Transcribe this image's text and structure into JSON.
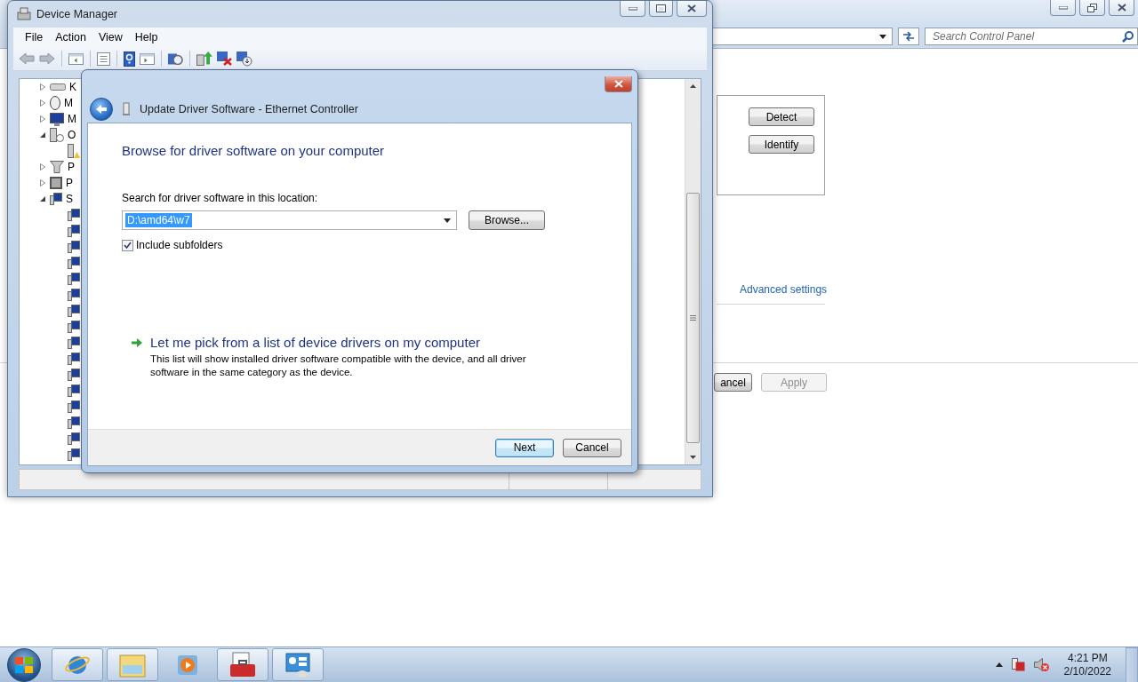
{
  "control_panel": {
    "search": {
      "placeholder": "Search Control Panel"
    },
    "buttons": [
      {
        "label": "Detect"
      },
      {
        "label": "Identify"
      }
    ],
    "link": "Advanced settings",
    "footer_buttons": [
      {
        "label": "ancel",
        "disabled": false
      },
      {
        "label": "Apply",
        "disabled": true
      }
    ]
  },
  "device_manager": {
    "title": "Device Manager",
    "menu": [
      "File",
      "Action",
      "View",
      "Help"
    ],
    "tree": [
      {
        "label": "K",
        "kind": "keyboard",
        "expanded": false
      },
      {
        "label": "M",
        "kind": "mouse",
        "expanded": false
      },
      {
        "label": "M",
        "kind": "monitor",
        "expanded": false
      },
      {
        "label": "O",
        "kind": "unknown",
        "expanded": true,
        "children": [
          {
            "kind": "warning"
          }
        ]
      },
      {
        "label": "P",
        "kind": "port",
        "expanded": false
      },
      {
        "label": "P",
        "kind": "processor",
        "expanded": false
      },
      {
        "label": "S",
        "kind": "system",
        "expanded": true,
        "children": [
          {
            "kind": "system"
          },
          {
            "kind": "system"
          },
          {
            "kind": "system"
          },
          {
            "kind": "system"
          },
          {
            "kind": "system"
          },
          {
            "kind": "system"
          },
          {
            "kind": "system"
          },
          {
            "kind": "system"
          },
          {
            "kind": "system"
          },
          {
            "kind": "system"
          },
          {
            "kind": "system"
          },
          {
            "kind": "system"
          },
          {
            "kind": "system"
          },
          {
            "kind": "system"
          },
          {
            "kind": "system"
          },
          {
            "kind": "system"
          }
        ]
      }
    ]
  },
  "dialog": {
    "title": "Update Driver Software - Ethernet Controller",
    "heading": "Browse for driver software on your computer",
    "location_label": "Search for driver software in this location:",
    "path": "D:\\amd64\\w7",
    "browse": "Browse...",
    "include_subfolders": {
      "label": "Include subfolders",
      "checked": true
    },
    "pick": {
      "title": "Let me pick from a list of device drivers on my computer",
      "description": "This list will show installed driver software compatible with the device, and all driver software in the same category as the device."
    },
    "buttons": [
      {
        "label": "Next",
        "focused": true
      },
      {
        "label": "Cancel",
        "focused": false
      }
    ]
  },
  "taskbar": {
    "apps": [
      {
        "kind": "browser"
      },
      {
        "kind": "folder"
      },
      {
        "kind": "media"
      },
      {
        "kind": "toolbox"
      },
      {
        "kind": "control-panel"
      }
    ],
    "time": "4:21 PM",
    "date": "2/10/2022"
  }
}
